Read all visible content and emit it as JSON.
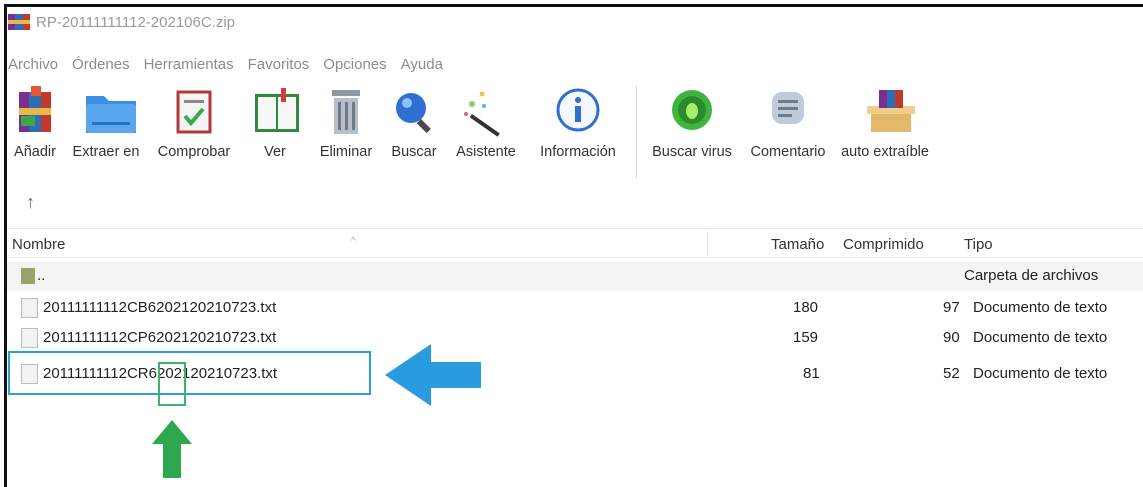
{
  "window": {
    "title": "RP-20111111112-202106C.zip"
  },
  "menu": [
    "Archivo",
    "Órdenes",
    "Herramientas",
    "Favoritos",
    "Opciones",
    "Ayuda"
  ],
  "toolbar": [
    {
      "label": "Añadir",
      "icon": "add-archive-icon"
    },
    {
      "label": "Extraer en",
      "icon": "folder-extract-icon"
    },
    {
      "label": "Comprobar",
      "icon": "test-check-icon"
    },
    {
      "label": "Ver",
      "icon": "book-view-icon"
    },
    {
      "label": "Eliminar",
      "icon": "trash-icon"
    },
    {
      "label": "Buscar",
      "icon": "magnifier-icon"
    },
    {
      "label": "Asistente",
      "icon": "wizard-wand-icon"
    },
    {
      "label": "Información",
      "icon": "info-icon"
    },
    {
      "label": "Buscar virus",
      "icon": "virus-scan-icon"
    },
    {
      "label": "Comentario",
      "icon": "comment-icon"
    },
    {
      "label": "auto extraíble",
      "icon": "sfx-archive-icon"
    }
  ],
  "columns": {
    "name": "Nombre",
    "size": "Tamaño",
    "packed": "Comprimido",
    "type": "Tipo"
  },
  "rows": [
    {
      "name": "..",
      "size": "",
      "packed": "",
      "type": "Carpeta de archivos"
    },
    {
      "name": "20111111112CB6202120210723.txt",
      "size": "180",
      "packed": "97",
      "type": "Documento de texto"
    },
    {
      "name": "20111111112CP6202120210723.txt",
      "size": "159",
      "packed": "90",
      "type": "Documento de texto"
    },
    {
      "name": "20111111112CR6202120210723.txt",
      "size": "81",
      "packed": "52",
      "type": "Documento de texto"
    }
  ],
  "colors": {
    "highlight_blue": "#2c9fd8",
    "highlight_green": "#3bb56a"
  }
}
